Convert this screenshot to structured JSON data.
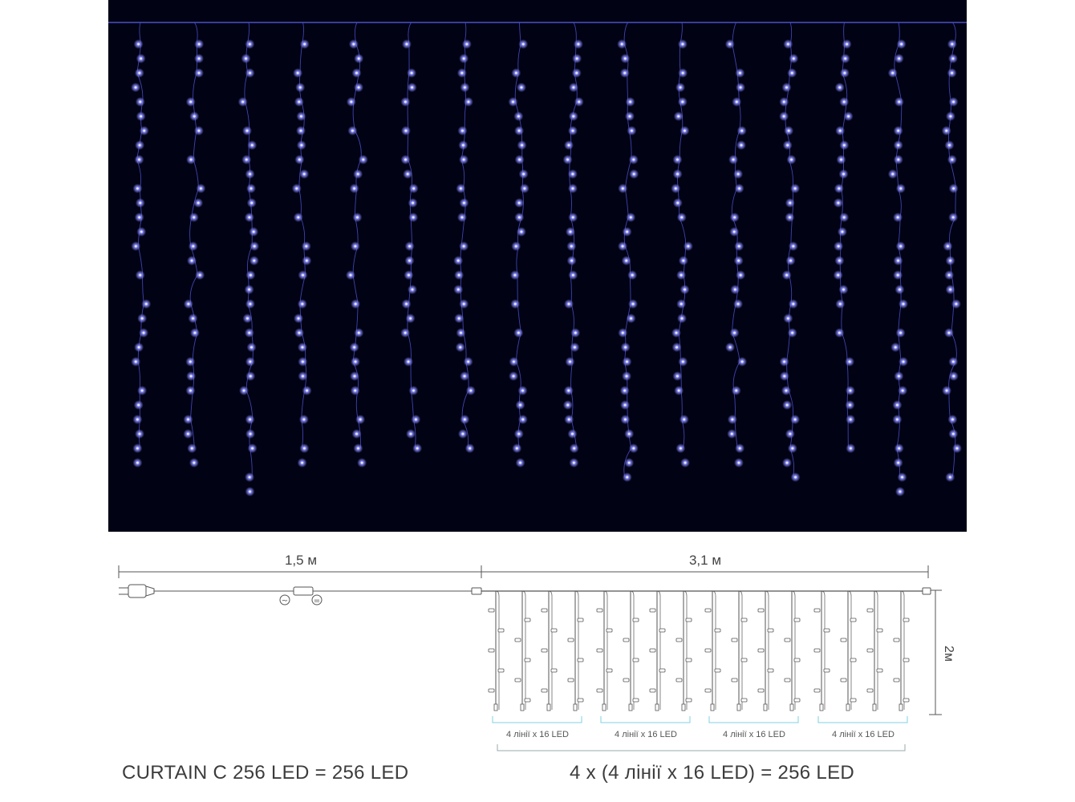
{
  "colors": {
    "photo_background": "#010214",
    "led": "#8a8cff",
    "led_core": "#e6e8ff",
    "wire": "#4a4fc8",
    "diagram_line": "#555555",
    "group_bracket": "#7fd0e6"
  },
  "photo": {
    "description_icon": "blue-led-curtain-photo",
    "strand_count": 16
  },
  "diagram": {
    "cable_length_label": "1,5 м",
    "curtain_width_label": "3,1 м",
    "curtain_height_label": "2м",
    "ac_symbol": "~",
    "dc_symbol": "=",
    "groups": [
      {
        "label": "4 лінії х 16 LED"
      },
      {
        "label": "4 лінії х 16 LED"
      },
      {
        "label": "4 лінії х 16 LED"
      },
      {
        "label": "4 лінії х 16 LED"
      }
    ]
  },
  "captions": {
    "left": "CURTAIN C 256 LED = 256 LED",
    "right": "4 х (4 лінії х 16 LED) = 256 LED"
  }
}
